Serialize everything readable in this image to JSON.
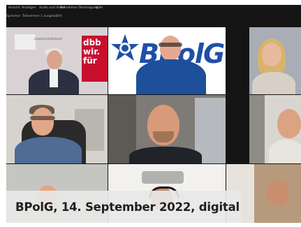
{
  "toolbar": {
    "items": [
      "Ansicht",
      "Anzeigen",
      "Audio und Video",
      "Teilnehmer",
      "Übertragung",
      "Hilfe"
    ]
  },
  "subtitle": "Sprecher: Teilnehmer 1  ausgewählt",
  "tiles": {
    "backdrop_dbb": "dbb wir. für",
    "backdrop_dbb_sub": "Gewerkschaftsbund",
    "bpolg_logo": "BPolG"
  },
  "caption": {
    "text": "BPolG, 14. September 2022, digital"
  },
  "colors": {
    "frame": "#151515",
    "caption_bg": "#e8e8e8",
    "caption_text": "#1f1f1f",
    "bpol_blue": "#1f4fa8",
    "dbb_red": "#c8102e"
  }
}
